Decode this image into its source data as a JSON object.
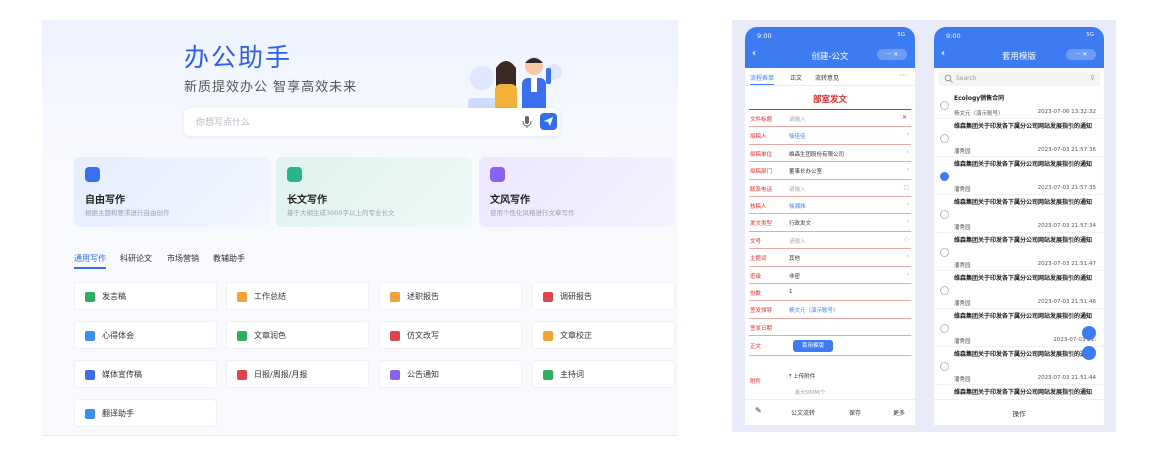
{
  "desktop": {
    "title": "办公助手",
    "subtitle": "新质提效办公  智享高效未来",
    "search_placeholder": "你想写点什么",
    "cards": [
      {
        "title": "自由写作",
        "desc": "根据主题和要求进行自由创作",
        "color": "#3a6ff0"
      },
      {
        "title": "长文写作",
        "desc": "基于大纲生成3000字以上的专业长文",
        "color": "#2bb38a"
      },
      {
        "title": "文风写作",
        "desc": "使用个性化风格进行文章写作",
        "color": "#8a62f0"
      }
    ],
    "tabs": [
      "通用写作",
      "科研论文",
      "市场营销",
      "教辅助手"
    ],
    "tools": [
      {
        "label": "发言稿",
        "color": "#2fae5f"
      },
      {
        "label": "工作总结",
        "color": "#f2a23a"
      },
      {
        "label": "述职报告",
        "color": "#f2a23a"
      },
      {
        "label": "调研报告",
        "color": "#e0434b"
      },
      {
        "label": "心得体会",
        "color": "#3a8ef0"
      },
      {
        "label": "文章润色",
        "color": "#2fae5f"
      },
      {
        "label": "仿文改写",
        "color": "#e0434b"
      },
      {
        "label": "文章校正",
        "color": "#f2a23a"
      },
      {
        "label": "媒体宣传稿",
        "color": "#3a6ff0"
      },
      {
        "label": "日报/周报/月报",
        "color": "#e0434b"
      },
      {
        "label": "公告通知",
        "color": "#8a62f0"
      },
      {
        "label": "主持词",
        "color": "#2fae5f"
      },
      {
        "label": "翻译助手",
        "color": "#3a8ef0"
      }
    ]
  },
  "phone1": {
    "time": "9:00",
    "status": "5G",
    "title": "创建-公文",
    "tabs": [
      "流程表单",
      "正文",
      "流转意见"
    ],
    "doc_title": "部室发文",
    "fields": [
      {
        "label": "文件标题",
        "value": "请输入",
        "style": "ph",
        "mark": "x"
      },
      {
        "label": "拟稿人",
        "value": "徐佳佳",
        "style": "link",
        "mark": "chev"
      },
      {
        "label": "拟稿单位",
        "value": "维森生团股份有限公司",
        "style": "",
        "mark": "chev"
      },
      {
        "label": "拟稿部门",
        "value": "董事长办公室",
        "style": "",
        "mark": "chev"
      },
      {
        "label": "联系电话",
        "value": "请输入",
        "style": "ph",
        "mark": "box"
      },
      {
        "label": "核稿人",
        "value": "徐湘炜",
        "style": "link",
        "mark": "chev"
      },
      {
        "label": "发文类型",
        "value": "行政发文",
        "style": "",
        "mark": "chev"
      },
      {
        "label": "文号",
        "value": "请输入",
        "style": "ph",
        "mark": "circ"
      },
      {
        "label": "主题词",
        "value": "其他",
        "style": "",
        "mark": "chev"
      },
      {
        "label": "密级",
        "value": "非密",
        "style": "",
        "mark": "chev"
      },
      {
        "label": "份数",
        "value": "1",
        "style": "",
        "mark": ""
      },
      {
        "label": "签发领导",
        "value": "杨文元（演示账号）",
        "style": "link",
        "mark": ""
      },
      {
        "label": "签发日期",
        "value": "",
        "style": "",
        "mark": ""
      }
    ],
    "body_label": "正文",
    "apply_template": "套用模版",
    "attachment_label": "附件",
    "upload": "上传附件",
    "upload_hint": "最大500M/个",
    "bottom": [
      "公文流转",
      "保存",
      "更多"
    ]
  },
  "phone2": {
    "time": "9:00",
    "status": "5G",
    "title": "套用模版",
    "search_placeholder": "Search",
    "items": [
      {
        "title": "Ecology销售合同",
        "author": "杨文元（演示账号）",
        "date": "2023-07-06 13:32:32",
        "checked": false
      },
      {
        "title": "维森集团关于印发各下属分公司网站发展指引的通知",
        "author": "潘秀园",
        "date": "2023-07-03 21:57:36",
        "checked": false
      },
      {
        "title": "维森集团关于印发各下属分公司网站发展指引的通知",
        "author": "潘秀园",
        "date": "2023-07-03 21:57:35",
        "checked": true
      },
      {
        "title": "维森集团关于印发各下属分公司网站发展指引的通知",
        "author": "潘秀园",
        "date": "2023-07-03 21:57:34",
        "checked": false
      },
      {
        "title": "维森集团关于印发各下属分公司网站发展指引的通知",
        "author": "潘秀园",
        "date": "2023-07-03 21:51:47",
        "checked": false
      },
      {
        "title": "维森集团关于印发各下属分公司网站发展指引的通知",
        "author": "潘秀园",
        "date": "2023-07-03 21:51:46",
        "checked": false
      },
      {
        "title": "维森集团关于印发各下属分公司网站发展指引的通知",
        "author": "潘秀园",
        "date": "2023-07-03 21:",
        "checked": false
      },
      {
        "title": "维森集团关于印发各下属分公司网站发展指引的通知",
        "author": "潘秀园",
        "date": "2023-07-03 21:51:44",
        "checked": false
      },
      {
        "title": "维森集团关于印发各下属分公司网站发展指引的通知",
        "author": "",
        "date": "",
        "checked": false
      }
    ],
    "operate": "操作"
  }
}
